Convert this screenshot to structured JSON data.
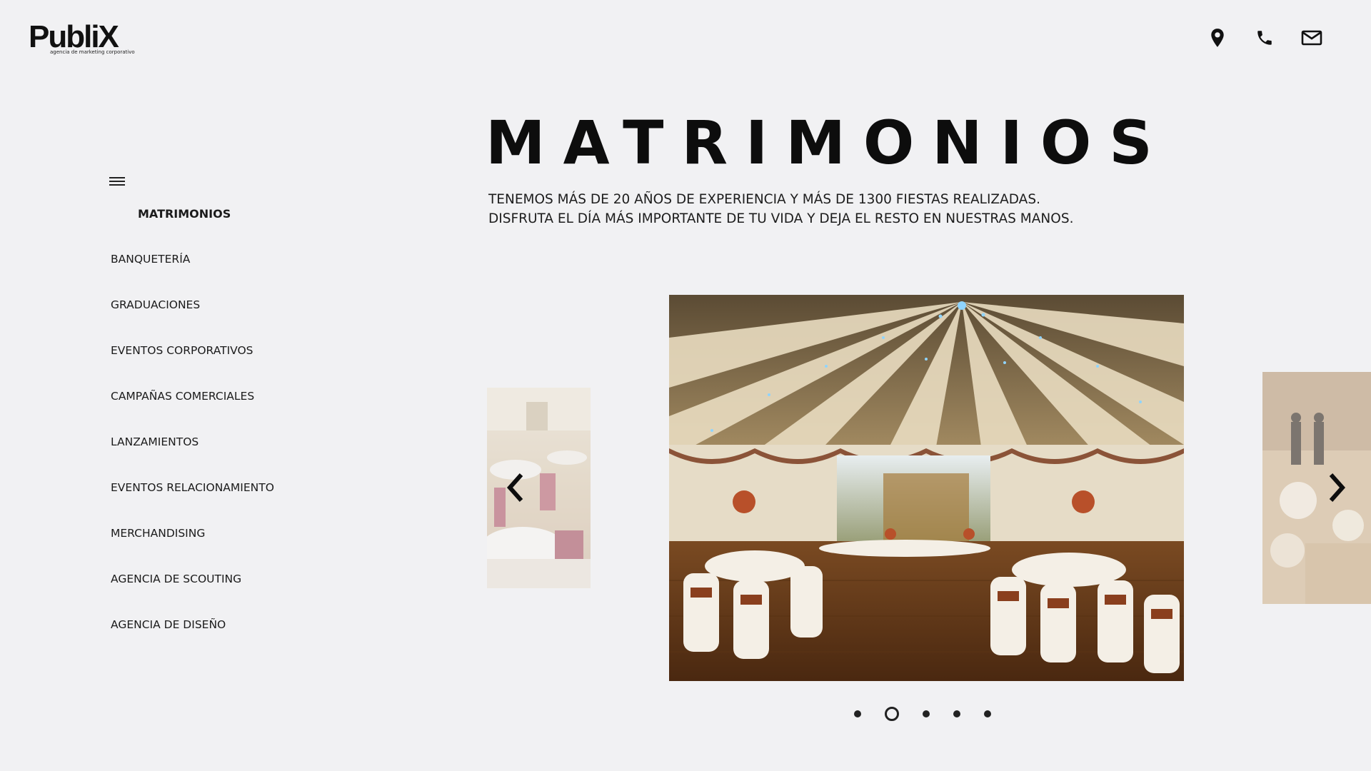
{
  "header": {
    "logo_text": "PubliX",
    "logo_tagline": "agencia de marketing corporativo",
    "icons": [
      "location-pin-icon",
      "phone-icon",
      "mail-icon"
    ]
  },
  "sidebar": {
    "menu_icon": "hamburger-icon",
    "items": [
      {
        "label": "MATRIMONIOS",
        "active": true
      },
      {
        "label": "BANQUETERÍA"
      },
      {
        "label": "GRADUACIONES"
      },
      {
        "label": "EVENTOS CORPORATIVOS"
      },
      {
        "label": "CAMPAÑAS COMERCIALES"
      },
      {
        "label": "LANZAMIENTOS"
      },
      {
        "label": "EVENTOS RELACIONAMIENTO"
      },
      {
        "label": "MERCHANDISING"
      },
      {
        "label": "AGENCIA DE SCOUTING"
      },
      {
        "label": "AGENCIA DE DISEÑO"
      }
    ]
  },
  "main": {
    "title": "MATRIMONIOS",
    "subtitle_line1": "TENEMOS MÁS DE 20 AÑOS DE EXPERIENCIA Y MÁS DE 1300 FIESTAS REALIZADAS.",
    "subtitle_line2": "DISFRUTA EL DÍA MÁS IMPORTANTE DE TU VIDA Y DEJA EL RESTO EN NUESTRAS MANOS."
  },
  "carousel": {
    "prev_icon": "chevron-left-icon",
    "next_icon": "chevron-right-icon",
    "slide_count": 5,
    "active_index": 1
  },
  "colors": {
    "background": "#f1f1f3",
    "text": "#111111"
  }
}
